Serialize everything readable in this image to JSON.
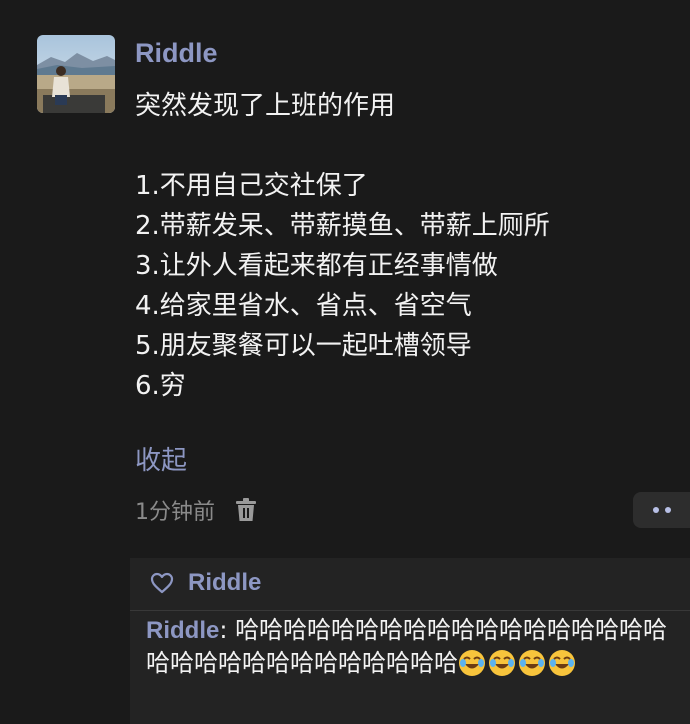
{
  "post": {
    "author": "Riddle",
    "title_line": "突然发现了上班的作用",
    "list": [
      "1.不用自己交社保了",
      "2.带薪发呆、带薪摸鱼、带薪上厕所",
      "3.让外人看起来都有正经事情做",
      "4.给家里省水、省点、省空气",
      "5.朋友聚餐可以一起吐槽领导",
      "6.穷"
    ],
    "collapse_label": "收起",
    "time": "1分钟前"
  },
  "likes": {
    "name": "Riddle"
  },
  "comment": {
    "author": "Riddle",
    "separator": ": ",
    "text": "哈哈哈哈哈哈哈哈哈哈哈哈哈哈哈哈哈哈哈哈哈哈哈哈哈哈哈哈哈哈哈",
    "emoji": "laughing-crying-emoji",
    "emoji_count": 4
  },
  "colors": {
    "background": "#1a1a1a",
    "name_accent": "#8d97c3",
    "body_text": "#f2f2f2",
    "muted_text": "#8a8a8a",
    "reply_box": "#232323"
  }
}
